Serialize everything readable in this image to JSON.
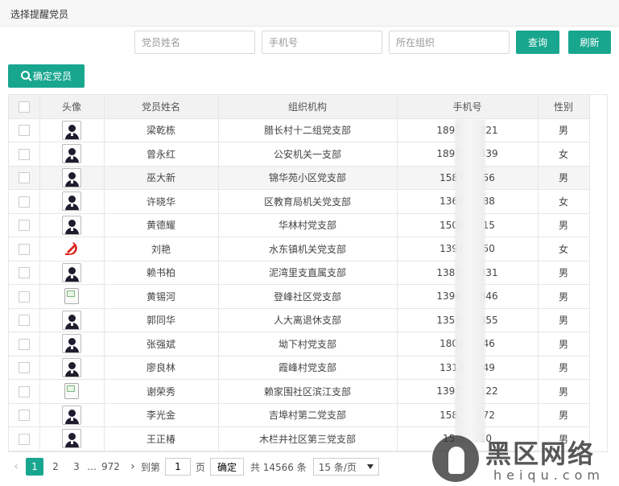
{
  "page": {
    "title": "选择提醒党员"
  },
  "search": {
    "name_placeholder": "党员姓名",
    "phone_placeholder": "手机号",
    "org_placeholder": "所在组织",
    "query_label": "查询",
    "refresh_label": "刷新"
  },
  "toolbar": {
    "confirm_label": "确定党员",
    "confirm_icon": "search-icon"
  },
  "table": {
    "columns": [
      "头像",
      "党员姓名",
      "组织机构",
      "手机号",
      "性别"
    ],
    "rows": [
      {
        "avatar": "default",
        "name": "梁乾栋",
        "org": "腊长村十二组党支部",
        "phone": "1897      221",
        "gender": "男"
      },
      {
        "avatar": "default",
        "name": "曾永红",
        "org": "公安机关一支部",
        "phone": "1897      339",
        "gender": "女"
      },
      {
        "avatar": "default",
        "name": "巫大新",
        "org": "锦华苑小区党支部",
        "phone": "1587      56",
        "gender": "男"
      },
      {
        "avatar": "default",
        "name": "许晓华",
        "org": "区教育局机关党支部",
        "phone": "1362      88",
        "gender": "女"
      },
      {
        "avatar": "default",
        "name": "黄德耀",
        "org": "华林村党支部",
        "phone": "1500      15",
        "gender": "男"
      },
      {
        "avatar": "party",
        "name": "刘艳",
        "org": "水东镇机关党支部",
        "phone": "1397      50",
        "gender": "女"
      },
      {
        "avatar": "default",
        "name": "赖书柏",
        "org": "泥湾里支直属支部",
        "phone": "1387      331",
        "gender": "男"
      },
      {
        "avatar": "broken",
        "name": "黄锡河",
        "org": "登峰社区党支部",
        "phone": "1390      846",
        "gender": "男"
      },
      {
        "avatar": "default",
        "name": "郭同华",
        "org": "人大离退休支部",
        "phone": "1357      355",
        "gender": "男"
      },
      {
        "avatar": "default",
        "name": "张强斌",
        "org": "坳下村党支部",
        "phone": "1807      46",
        "gender": "男"
      },
      {
        "avatar": "default",
        "name": "廖良林",
        "org": "霞峰村党支部",
        "phone": "1313      49",
        "gender": "男"
      },
      {
        "avatar": "broken",
        "name": "谢荣秀",
        "org": "赖家围社区滨江支部",
        "phone": "1397      122",
        "gender": "男"
      },
      {
        "avatar": "default",
        "name": "李光金",
        "org": "吉埠村第二党支部",
        "phone": "158      572",
        "gender": "男"
      },
      {
        "avatar": "default",
        "name": "王正椿",
        "org": "木栏井社区第三党支部",
        "phone": "15      310",
        "gender": "男"
      }
    ]
  },
  "pagination": {
    "pages": [
      "1",
      "2",
      "3"
    ],
    "ellipsis": "…",
    "last_page": "972",
    "goto_label": "到第",
    "goto_value": "1",
    "page_unit": "页",
    "confirm_label": "确定",
    "total_label": "共 14566 条",
    "page_size": "15 条/页"
  },
  "watermark": {
    "title": "黑区网络",
    "subtitle": "heiqu.com"
  }
}
